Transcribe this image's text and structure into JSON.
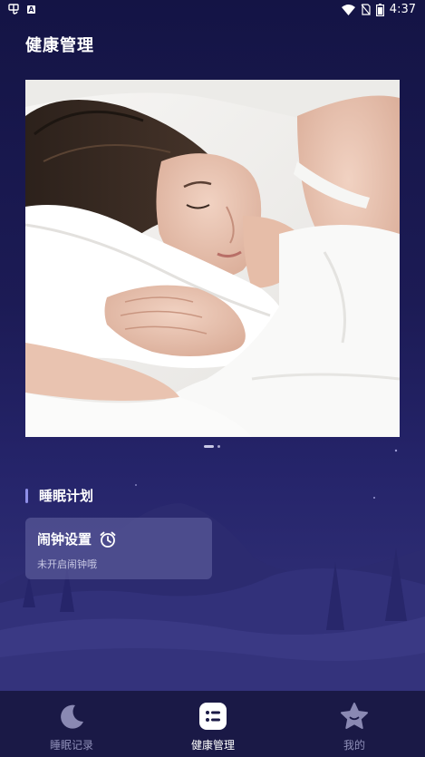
{
  "status_bar": {
    "time": "4:37",
    "battery_level": "65%",
    "left_icons": [
      "bug-notification-icon",
      "a-notification-icon"
    ],
    "right_icons": [
      "wifi-icon",
      "no-sim-icon",
      "battery-icon"
    ]
  },
  "header": {
    "title": "健康管理"
  },
  "banner": {
    "image": "sleeping-woman-photo",
    "page_count": 2,
    "active_page": 1
  },
  "section": {
    "title": "睡眠计划"
  },
  "alarm": {
    "title": "闹钟设置",
    "status": "未开启闹钟哦",
    "icon": "alarm-clock-icon"
  },
  "bottom_nav": {
    "items": [
      {
        "label": "睡眠记录",
        "icon": "moon-icon",
        "active": false
      },
      {
        "label": "健康管理",
        "icon": "list-icon",
        "active": true
      },
      {
        "label": "我的",
        "icon": "star-icon",
        "active": false
      }
    ]
  },
  "colors": {
    "background": "#1c1b55",
    "accent": "#8f8fe8",
    "nav_background": "#1a1946",
    "card": "#6867a5"
  }
}
